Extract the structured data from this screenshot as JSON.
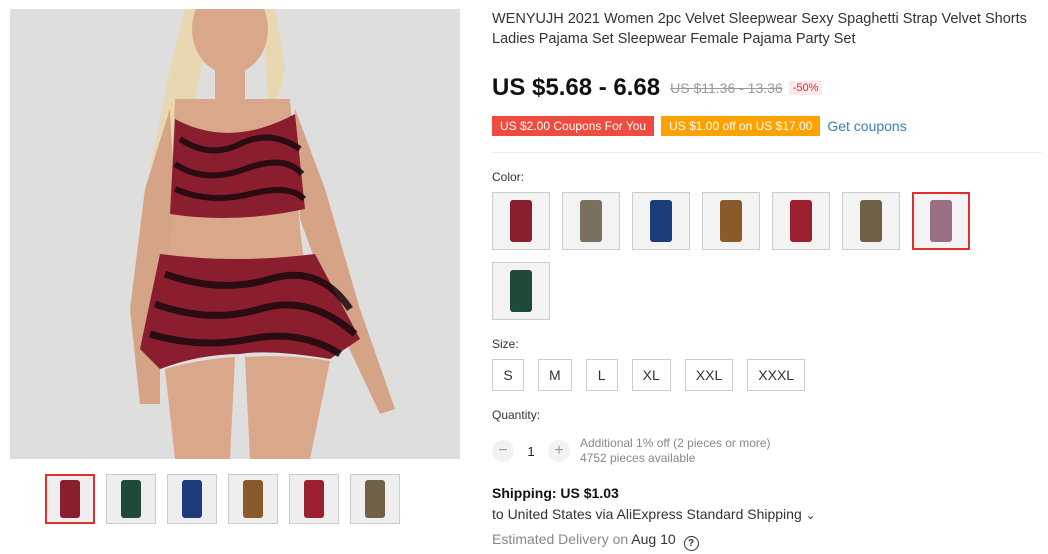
{
  "product": {
    "title": "WENYUJH 2021 Women 2pc Velvet Sleepwear Sexy Spaghetti Strap Velvet Shorts Ladies Pajama Set Sleepwear Female Pajama Party Set",
    "price": "US $5.68 - 6.68",
    "original_price": "US $11.36 - 13.36",
    "discount": "-50%"
  },
  "coupons": {
    "coupon1": "US $2.00 Coupons For You",
    "coupon2": "US $1.00 off on US $17.00",
    "get_coupons": "Get coupons"
  },
  "color": {
    "label": "Color:",
    "swatches": [
      {
        "color": "#8b1e2e"
      },
      {
        "color": "#7a7060"
      },
      {
        "color": "#1c3d7a"
      },
      {
        "color": "#8a5a2b"
      },
      {
        "color": "#9b1f2e"
      },
      {
        "color": "#6e6146"
      },
      {
        "color": "#9a6e83",
        "selected": true
      },
      {
        "color": "#1f4a37"
      }
    ]
  },
  "size": {
    "label": "Size:",
    "options": [
      "S",
      "M",
      "L",
      "XL",
      "XXL",
      "XXXL"
    ]
  },
  "quantity": {
    "label": "Quantity:",
    "minus": "−",
    "value": "1",
    "plus": "+",
    "additional": "Additional 1% off (2 pieces or more)",
    "available": "4752 pieces available"
  },
  "shipping": {
    "title": "Shipping: US $1.03",
    "to": "to United States via AliExpress Standard Shipping",
    "chevron": "⌄",
    "delivery_label": "Estimated Delivery on",
    "delivery_date": "Aug 10",
    "help_icon": "?"
  },
  "thumbnails": [
    {
      "color": "#8b1e2e",
      "selected": true
    },
    {
      "color": "#1f4a37"
    },
    {
      "color": "#1c3d7a"
    },
    {
      "color": "#8a5a2b"
    },
    {
      "color": "#9b1f2e"
    },
    {
      "color": "#6e6146"
    }
  ]
}
